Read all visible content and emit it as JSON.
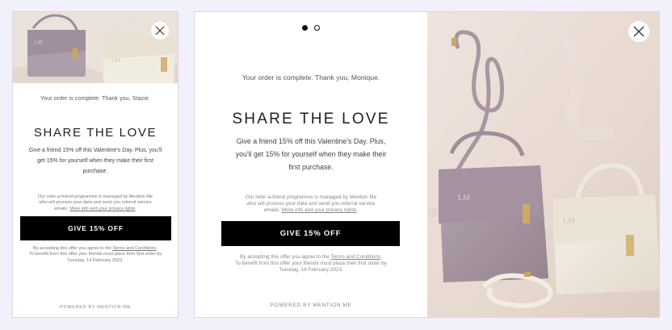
{
  "mobile": {
    "thanks": "Your order is complete. Thank you, Stacie.",
    "heading": "SHARE THE LOVE",
    "offer_line1": "Give a friend 15% off this Valentine's Day. Plus, you'll",
    "offer_line2": "get 15% for yourself when they make their first",
    "offer_line3": "purchase.",
    "legal_line1": "Our refer-a-friend programme is managed by Mention Me",
    "legal_line2": "who will process your data and send you referral service",
    "legal_line3_prefix": "emails. ",
    "legal_link": "More info and your privacy rights",
    "legal_line3_suffix": ".",
    "cta_label": "GIVE 15% OFF",
    "terms_prefix": "By accepting this offer you agree to the ",
    "terms_link": "Terms and Conditions",
    "terms_suffix": ".",
    "terms_line2": "To benefit from this offer your friends must place their first order by",
    "terms_line3": "Tuesday, 14 February 2023.",
    "powered": "POWERED BY MENTION ME",
    "monogram": "LM"
  },
  "desktop": {
    "thanks": "Your order is complete. Thank you, Monique.",
    "heading": "SHARE THE LOVE",
    "offer_line1": "Give a friend 15% off this Valentine's Day. Plus,",
    "offer_line2": "you'll get 15% for yourself when they make their",
    "offer_line3": "first purchase.",
    "legal_line1": "Our refer-a-friend programme is managed by Mention Me",
    "legal_line2": "who will process your data and send you referral service",
    "legal_line3_prefix": "emails. ",
    "legal_link": "More info and your privacy rights",
    "legal_line3_suffix": ".",
    "cta_label": "GIVE 15% OFF",
    "terms_prefix": "By accepting this offer you agree to the ",
    "terms_link": "Terms and Conditions",
    "terms_suffix": ".",
    "terms_line2": "To benefit from this offer your friends must place their first order by",
    "terms_line3": "Tuesday, 14 February 2023.",
    "powered": "POWERED BY MENTION ME",
    "monogram_front": "LM",
    "monogram_back": "LM",
    "slides_total": 2,
    "slide_active": 1
  },
  "colors": {
    "background": "#f1f0fb",
    "cta": "#000000",
    "bag_mauve": "#a99aa6",
    "bag_cream": "#efe9dc",
    "backdrop": "#e9dcd5"
  }
}
